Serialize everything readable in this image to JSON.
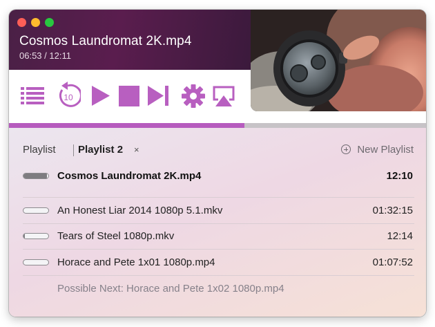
{
  "window": {
    "title": "Cosmos Laundromat 2K.mp4",
    "time": "06:53 / 12:11",
    "progress_fraction": 0.565
  },
  "controls": [
    {
      "name": "playlist-icon"
    },
    {
      "name": "rewind-10-icon",
      "label": "10"
    },
    {
      "name": "play-icon"
    },
    {
      "name": "stop-icon"
    },
    {
      "name": "next-track-icon"
    },
    {
      "name": "settings-gear-icon"
    },
    {
      "name": "airplay-icon"
    }
  ],
  "colors": {
    "accent": "#b65bbe",
    "header_start": "#4a2046",
    "header_end": "#3b1a3c"
  },
  "tabs": [
    {
      "label": "Playlist",
      "active": false
    },
    {
      "label": "Playlist 2",
      "active": true,
      "close": "×"
    }
  ],
  "new_playlist_label": "New Playlist",
  "playlist": [
    {
      "name": "Cosmos Laundromat 2K.mp4",
      "duration": "12:10",
      "current": true,
      "progress": 0.95
    },
    {
      "name": "An Honest Liar 2014 1080p 5.1.mkv",
      "duration": "01:32:15",
      "current": false,
      "progress": 0.0
    },
    {
      "name": "Tears of Steel 1080p.mkv",
      "duration": "12:14",
      "current": false,
      "progress": 0.06
    },
    {
      "name": "Horace and Pete 1x01 1080p.mp4",
      "duration": "01:07:52",
      "current": false,
      "progress": 0.0
    }
  ],
  "possible_next": "Possible Next: Horace and Pete 1x02 1080p.mp4"
}
